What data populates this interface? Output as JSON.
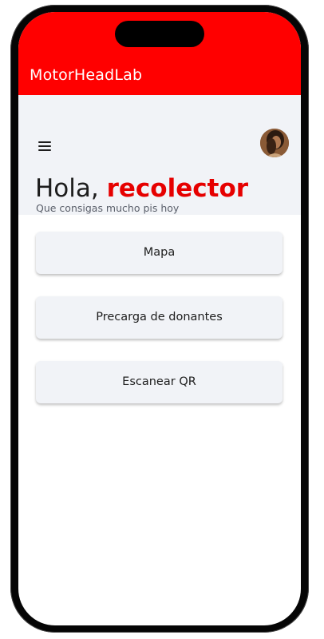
{
  "app": {
    "title": "MotorHeadLab"
  },
  "header": {
    "greeting_prefix": "Hola, ",
    "greeting_role": "recolector",
    "subtitle": "Que consigas mucho pis hoy"
  },
  "actions": [
    {
      "label": "Mapa"
    },
    {
      "label": "Precarga de donantes"
    },
    {
      "label": "Escanear QR"
    }
  ],
  "icons": {
    "menu": "menu-icon",
    "avatar": "avatar"
  },
  "colors": {
    "brand": "#ff0000",
    "accent_text": "#e60000",
    "surface": "#f1f3f7"
  }
}
